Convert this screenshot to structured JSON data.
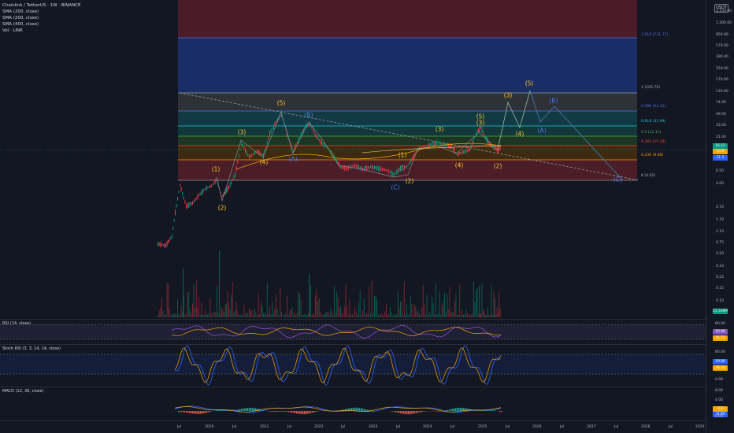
{
  "header": {
    "symbol_line": "Chainlink / TetherUS · 1W · BINANCE",
    "indicators": [
      "SMA (200, close)",
      "SMA (200, close)",
      "SMA (400, close)",
      "Vol · LINK"
    ]
  },
  "price_axis": {
    "currency_button": "USDT",
    "ticks": [
      "2,100.00",
      "1,300.00",
      "850.00",
      "570.00",
      "390.00",
      "250.00",
      "170.00",
      "110.00",
      "74.00",
      "49.00",
      "33.00",
      "21.00",
      "13.00",
      "8.50",
      "6.50",
      "4.00",
      "2.70",
      "1.70",
      "1.10",
      "0.75",
      "0.50",
      "0.33",
      "0.22",
      "0.15",
      "0.10",
      "0.06"
    ],
    "badges": [
      {
        "text": "16.12",
        "color": "#089981"
      },
      {
        "text": "13.9",
        "color": "#f7a600"
      },
      {
        "text": "11.3",
        "color": "#2962ff"
      },
      {
        "text": "21.516M",
        "color": "#089981"
      }
    ]
  },
  "fib_levels": [
    {
      "label": "1.618 (731.77)",
      "color": "#4a76e8"
    },
    {
      "label": "1 (105.75)",
      "color": "#b2b5be"
    },
    {
      "label": "0.786 (54.12)",
      "color": "#4a76e8"
    },
    {
      "label": "0.618 (31.99)",
      "color": "#26c6da"
    },
    {
      "label": "0.5 (22.11)",
      "color": "#4caf50"
    },
    {
      "label": "0.382 (15.28)",
      "color": "#f44336"
    },
    {
      "label": "0.236 (9.68)",
      "color": "#ff9800"
    },
    {
      "label": "0 (4.42)",
      "color": "#b2b5be"
    }
  ],
  "waves": [
    {
      "t": "(1)",
      "c": "y"
    },
    {
      "t": "(2)",
      "c": "y"
    },
    {
      "t": "(3)",
      "c": "y"
    },
    {
      "t": "(4)",
      "c": "y"
    },
    {
      "t": "(5)",
      "c": "y"
    },
    {
      "t": "(A)",
      "c": "b"
    },
    {
      "t": "(B)",
      "c": "b"
    },
    {
      "t": "(C)",
      "c": "b"
    },
    {
      "t": "(1)",
      "c": "y"
    },
    {
      "t": "(2)",
      "c": "y"
    },
    {
      "t": "(3)",
      "c": "y"
    },
    {
      "t": "(4)",
      "c": "y"
    },
    {
      "t": "(5)",
      "c": "y"
    },
    {
      "t": "(1)",
      "c": "y"
    },
    {
      "t": "(2)",
      "c": "y"
    },
    {
      "t": "(3)",
      "c": "y"
    },
    {
      "t": "(4)",
      "c": "y"
    },
    {
      "t": "(5)",
      "c": "y"
    },
    {
      "t": "(A)",
      "c": "b"
    },
    {
      "t": "(B)",
      "c": "b"
    },
    {
      "t": "(C)",
      "c": "b"
    }
  ],
  "rsi": {
    "label": "RSI (14, close)",
    "ticks": [
      "80.00",
      "40.00"
    ],
    "badges": [
      {
        "text": "50.96",
        "color": "#7e57c2"
      },
      {
        "text": "45.71",
        "color": "#f7a600"
      }
    ]
  },
  "stoch": {
    "label": "Stoch RSI (3, 3, 14, 14, close)",
    "ticks": [
      "80.00",
      "0.00"
    ],
    "badges": [
      {
        "text": "59.06",
        "color": "#2962ff"
      },
      {
        "text": "36.33",
        "color": "#f7a600"
      }
    ]
  },
  "macd": {
    "label": "MACD (12, 26, close)",
    "ticks": [
      "8.00",
      "4.00",
      "0.00"
    ],
    "badges": [
      {
        "text": "-0.6",
        "color": "#f7a600"
      },
      {
        "text": "-0.49",
        "color": "#2962ff"
      },
      {
        "text": "0.1",
        "color": "#b2b5be"
      }
    ]
  },
  "time_axis": [
    "Jul",
    "2020",
    "Jul",
    "2021",
    "Jul",
    "2022",
    "Jul",
    "2023",
    "Jul",
    "2024",
    "Jul",
    "2025",
    "Jul",
    "2026",
    "Jul",
    "2027",
    "Jul",
    "2028",
    "Jul",
    "2029"
  ]
}
